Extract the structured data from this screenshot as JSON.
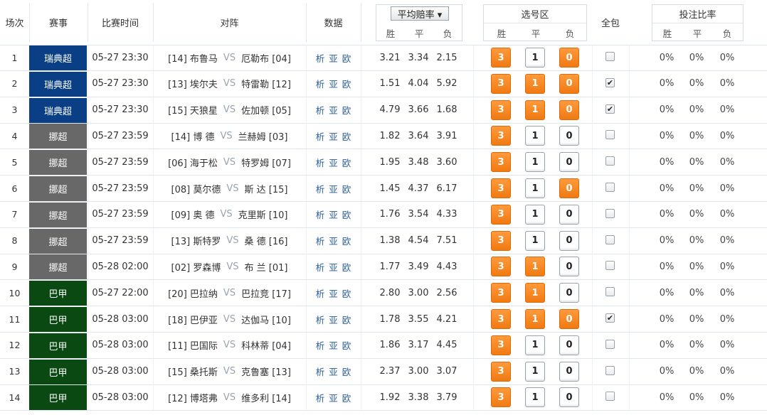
{
  "header": {
    "round": "场次",
    "league": "赛事",
    "time": "比赛时间",
    "match": "对阵",
    "data": "数据",
    "odds_select": "平均赔率 ▾",
    "odds_sub": [
      "胜",
      "平",
      "负"
    ],
    "pick_area": "选号区",
    "pick_sub": [
      "胜",
      "平",
      "负"
    ],
    "all_in": "全包",
    "bet_ratio": "投注比率",
    "ratio_sub": [
      "胜",
      "平",
      "负"
    ]
  },
  "colors": {
    "swe": "#0a3f86",
    "nor": "#686868",
    "bra": "#0a4a12",
    "selected_btn": "#f5841f"
  },
  "data_links": [
    "析",
    "亚",
    "欧"
  ],
  "rows": [
    {
      "no": "1",
      "league": "瑞典超",
      "lk": "swe",
      "time": "05-27 23:30",
      "home": "[14] 布鲁马",
      "away": "厄勒布 [04]",
      "odds": [
        "3.21",
        "3.34",
        "2.15"
      ],
      "pick": [
        true,
        false,
        true
      ],
      "all": false,
      "ratio": [
        "0%",
        "0%",
        "0%"
      ]
    },
    {
      "no": "2",
      "league": "瑞典超",
      "lk": "swe",
      "time": "05-27 23:30",
      "home": "[13] 埃尔夫",
      "away": "特雷勒 [12]",
      "odds": [
        "1.51",
        "4.04",
        "5.92"
      ],
      "pick": [
        true,
        true,
        true
      ],
      "all": true,
      "ratio": [
        "0%",
        "0%",
        "0%"
      ]
    },
    {
      "no": "3",
      "league": "瑞典超",
      "lk": "swe",
      "time": "05-27 23:30",
      "home": "[15] 天狼星",
      "away": "佐加顿 [05]",
      "odds": [
        "4.79",
        "3.66",
        "1.68"
      ],
      "pick": [
        true,
        true,
        true
      ],
      "all": true,
      "ratio": [
        "0%",
        "0%",
        "0%"
      ]
    },
    {
      "no": "4",
      "league": "挪超",
      "lk": "nor",
      "time": "05-27 23:59",
      "home": "[14]  博  德",
      "away": "兰赫姆 [03]",
      "odds": [
        "1.82",
        "3.64",
        "3.91"
      ],
      "pick": [
        true,
        false,
        false
      ],
      "all": false,
      "ratio": [
        "0%",
        "0%",
        "0%"
      ]
    },
    {
      "no": "5",
      "league": "挪超",
      "lk": "nor",
      "time": "05-27 23:59",
      "home": "[06] 海于松",
      "away": "特罗姆 [07]",
      "odds": [
        "1.95",
        "3.48",
        "3.60"
      ],
      "pick": [
        true,
        false,
        false
      ],
      "all": false,
      "ratio": [
        "0%",
        "0%",
        "0%"
      ]
    },
    {
      "no": "6",
      "league": "挪超",
      "lk": "nor",
      "time": "05-27 23:59",
      "home": "[08] 莫尔德",
      "away": "斯  达  [15]",
      "odds": [
        "1.45",
        "4.37",
        "6.17"
      ],
      "pick": [
        true,
        false,
        true
      ],
      "all": false,
      "ratio": [
        "0%",
        "0%",
        "0%"
      ]
    },
    {
      "no": "7",
      "league": "挪超",
      "lk": "nor",
      "time": "05-27 23:59",
      "home": "[09]  奥  德",
      "away": "克里斯 [10]",
      "odds": [
        "1.76",
        "3.54",
        "4.33"
      ],
      "pick": [
        true,
        false,
        false
      ],
      "all": false,
      "ratio": [
        "0%",
        "0%",
        "0%"
      ]
    },
    {
      "no": "8",
      "league": "挪超",
      "lk": "nor",
      "time": "05-27 23:59",
      "home": "[13] 斯特罗",
      "away": "桑  德  [16]",
      "odds": [
        "1.38",
        "4.54",
        "7.51"
      ],
      "pick": [
        true,
        false,
        false
      ],
      "all": false,
      "ratio": [
        "0%",
        "0%",
        "0%"
      ]
    },
    {
      "no": "9",
      "league": "挪超",
      "lk": "nor",
      "time": "05-28 02:00",
      "home": "[02] 罗森博",
      "away": "布  兰  [01]",
      "odds": [
        "1.77",
        "3.49",
        "4.43"
      ],
      "pick": [
        true,
        true,
        false
      ],
      "all": false,
      "ratio": [
        "0%",
        "0%",
        "0%"
      ]
    },
    {
      "no": "10",
      "league": "巴甲",
      "lk": "bra",
      "time": "05-27 22:00",
      "home": "[20] 巴拉纳",
      "away": "巴拉竞 [17]",
      "odds": [
        "2.80",
        "3.00",
        "2.56"
      ],
      "pick": [
        true,
        true,
        false
      ],
      "all": false,
      "ratio": [
        "0%",
        "0%",
        "0%"
      ]
    },
    {
      "no": "11",
      "league": "巴甲",
      "lk": "bra",
      "time": "05-28 03:00",
      "home": "[18] 巴伊亚",
      "away": "达伽马 [10]",
      "odds": [
        "1.78",
        "3.55",
        "4.21"
      ],
      "pick": [
        true,
        true,
        true
      ],
      "all": true,
      "ratio": [
        "0%",
        "0%",
        "0%"
      ]
    },
    {
      "no": "12",
      "league": "巴甲",
      "lk": "bra",
      "time": "05-28 03:00",
      "home": "[11] 巴国际",
      "away": "科林蒂 [04]",
      "odds": [
        "1.86",
        "3.17",
        "4.45"
      ],
      "pick": [
        true,
        false,
        false
      ],
      "all": false,
      "ratio": [
        "0%",
        "0%",
        "0%"
      ]
    },
    {
      "no": "13",
      "league": "巴甲",
      "lk": "bra",
      "time": "05-28 03:00",
      "home": "[15] 桑托斯",
      "away": "克鲁塞 [13]",
      "odds": [
        "2.37",
        "3.00",
        "3.07"
      ],
      "pick": [
        true,
        false,
        false
      ],
      "all": false,
      "ratio": [
        "0%",
        "0%",
        "0%"
      ]
    },
    {
      "no": "14",
      "league": "巴甲",
      "lk": "bra",
      "time": "05-28 03:00",
      "home": "[12] 博塔弗",
      "away": "维多利 [14]",
      "odds": [
        "1.92",
        "3.38",
        "3.79"
      ],
      "pick": [
        true,
        false,
        false
      ],
      "all": false,
      "ratio": [
        "0%",
        "0%",
        "0%"
      ]
    }
  ],
  "pick_labels": [
    "3",
    "1",
    "0"
  ],
  "vs": "VS",
  "check_mark": "✔"
}
